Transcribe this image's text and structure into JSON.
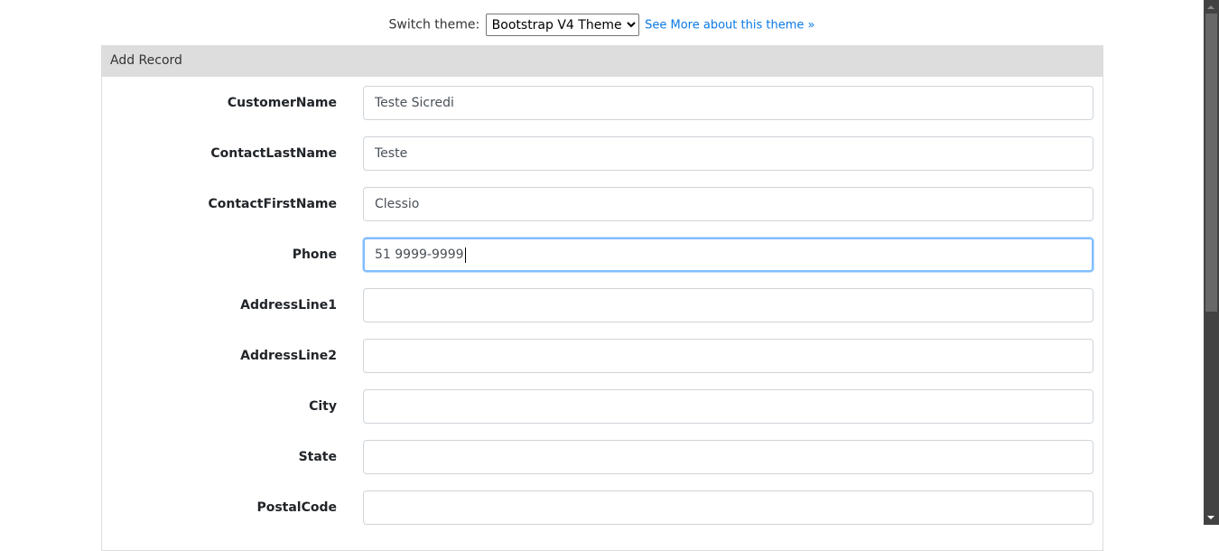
{
  "theme_switcher": {
    "label": "Switch theme:",
    "selected": "Bootstrap V4 Theme",
    "link": "See More about this theme »"
  },
  "panel": {
    "title": "Add Record"
  },
  "fields": [
    {
      "label": "CustomerName",
      "value": "Teste Sicredi"
    },
    {
      "label": "ContactLastName",
      "value": "Teste"
    },
    {
      "label": "ContactFirstName",
      "value": "Clessio"
    },
    {
      "label": "Phone",
      "value": "51 9999-9999"
    },
    {
      "label": "AddressLine1",
      "value": ""
    },
    {
      "label": "AddressLine2",
      "value": ""
    },
    {
      "label": "City",
      "value": ""
    },
    {
      "label": "State",
      "value": ""
    },
    {
      "label": "PostalCode",
      "value": ""
    }
  ],
  "focused_field": "Phone"
}
